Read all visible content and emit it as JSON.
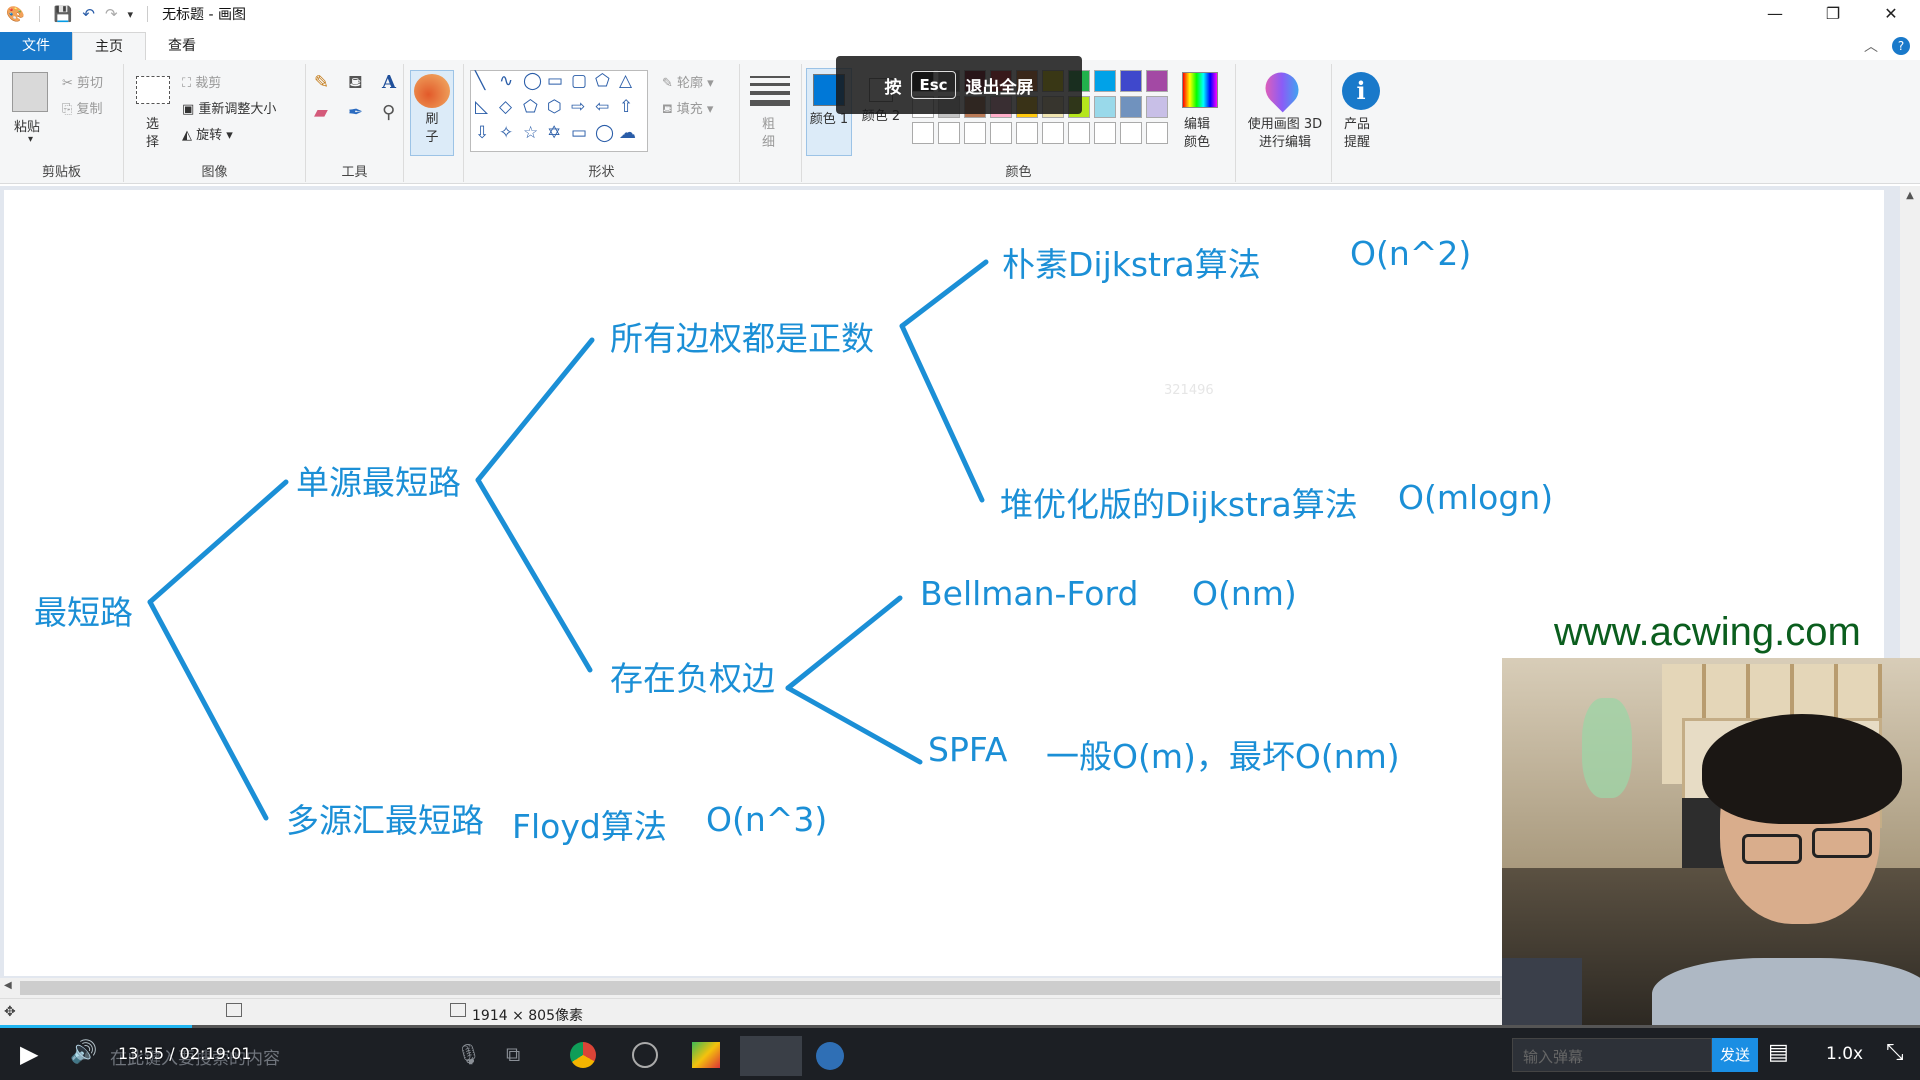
{
  "titlebar": {
    "title": "无标题 - 画图",
    "min": "—",
    "max": "❐",
    "close": "✕"
  },
  "tabs": [
    {
      "label": "文件"
    },
    {
      "label": "主页"
    },
    {
      "label": "查看"
    }
  ],
  "ribbon": {
    "clipboard": {
      "paste": "粘贴",
      "cut": "剪切",
      "copy": "复制",
      "group": "剪贴板"
    },
    "image": {
      "select": "选择",
      "crop": "裁剪",
      "resize": "重新调整大小",
      "rotate": "旋转",
      "group": "图像"
    },
    "tools": {
      "group": "工具"
    },
    "brushes": {
      "label": "刷子"
    },
    "shapes": {
      "outline": "轮廓",
      "fill": "填充",
      "group": "形状"
    },
    "size": {
      "label": "粗细"
    },
    "colors": {
      "color1": "颜色 1",
      "color2": "颜色 2",
      "edit": "编辑颜色",
      "group": "颜色"
    },
    "paint3d": {
      "label": "使用画图 3D 进行编辑"
    },
    "product_alert": {
      "label": "产品提醒"
    }
  },
  "palette": [
    "#000000",
    "#7f7f7f",
    "#880015",
    "#ed1c24",
    "#ff7f27",
    "#fff200",
    "#22b14c",
    "#00a2e8",
    "#3f48cc",
    "#a349a4",
    "#ffffff",
    "#c3c3c3",
    "#b97a57",
    "#ffaec9",
    "#ffc90e",
    "#efe4b0",
    "#b5e61d",
    "#99d9ea",
    "#7092be",
    "#c8bfe7"
  ],
  "esc_overlay": {
    "press": "按",
    "key": "Esc",
    "exit": "退出全屏"
  },
  "mindmap": {
    "root": "最短路",
    "single_source": "单源最短路",
    "all_positive": "所有边权都是正数",
    "naive_dijkstra": "朴素Dijkstra算法",
    "naive_dijkstra_cplx": "O(n^2)",
    "heap_dijkstra": "堆优化版的Dijkstra算法",
    "heap_dijkstra_cplx": "O(mlogn)",
    "negative_edges": "存在负权边",
    "bellman_ford": "Bellman-Ford",
    "bellman_ford_cplx": "O(nm)",
    "spfa": "SPFA",
    "spfa_cplx": "一般O(m)，最坏O(nm)",
    "multi_source": "多源汇最短路",
    "floyd": "Floyd算法",
    "floyd_cplx": "O(n^3)"
  },
  "watermark": "321496",
  "site": "www.acwing.com",
  "status": {
    "canvas_size": "1914 × 805像素"
  },
  "player": {
    "time": "13:55 / 02:19:01",
    "search_placeholder": "在此键入要搜索的内容",
    "danmaku_placeholder": "输入弹幕",
    "send": "发送",
    "speed": "1.0x",
    "progress": 0.1
  },
  "colors": {
    "accent": "#1979ca",
    "mind": "#1b8fd6"
  }
}
